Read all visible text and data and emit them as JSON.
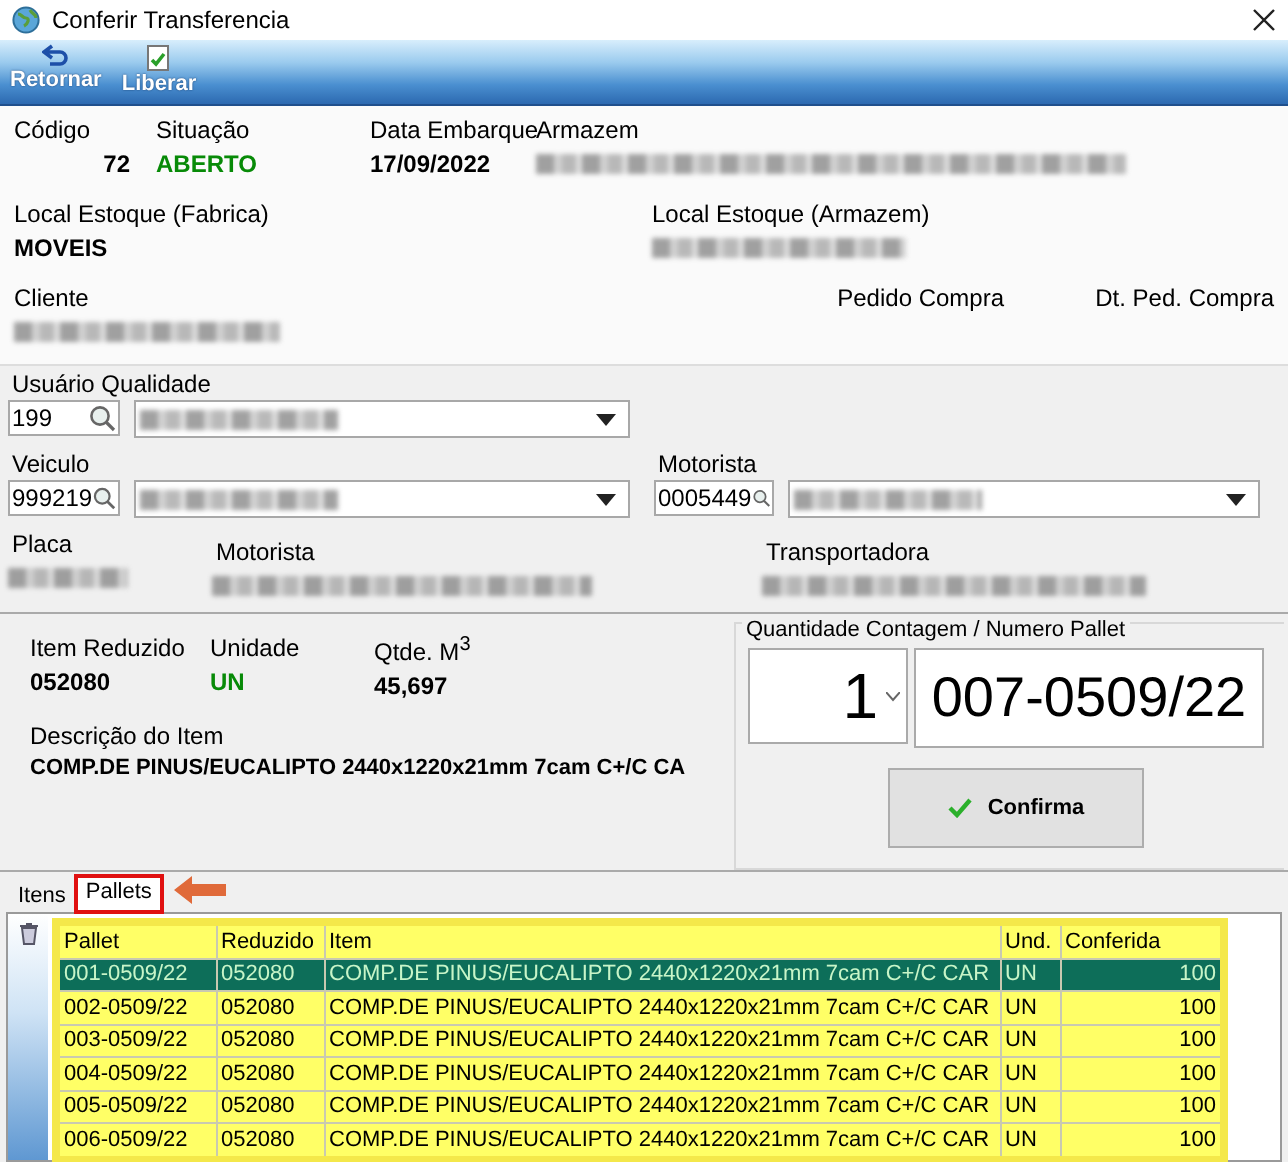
{
  "window": {
    "title": "Conferir Transferencia"
  },
  "toolbar": [
    {
      "label": "Retornar",
      "kind": "return"
    },
    {
      "label": "Liberar",
      "kind": "release"
    }
  ],
  "header": {
    "codigo": {
      "label": "Código",
      "value": "72"
    },
    "situacao": {
      "label": "Situação",
      "value": "ABERTO"
    },
    "data_embarque": {
      "label": "Data Embarque",
      "value": "17/09/2022"
    },
    "armazem": {
      "label": "Armazem",
      "redacted": true
    },
    "local_fabrica": {
      "label": "Local Estoque (Fabrica)",
      "value": "MOVEIS"
    },
    "local_armazem": {
      "label": "Local Estoque (Armazem)",
      "redacted": true
    },
    "cliente": {
      "label": "Cliente",
      "redacted": true
    },
    "pedido_compra": {
      "label": "Pedido Compra"
    },
    "dt_ped_compra": {
      "label": "Dt. Ped. Compra"
    }
  },
  "form": {
    "usuario_qualidade": {
      "label": "Usuário Qualidade",
      "code": "199",
      "redacted": true
    },
    "veiculo": {
      "label": "Veiculo",
      "code": "999219",
      "redacted": true
    },
    "motorista": {
      "label": "Motorista",
      "code": "0005449",
      "redacted": true
    },
    "placa": {
      "label": "Placa",
      "redacted": true
    },
    "motorista_nome": {
      "label": "Motorista",
      "redacted": true
    },
    "transportadora": {
      "label": "Transportadora",
      "redacted": true
    }
  },
  "item": {
    "item_reduzido": {
      "label": "Item Reduzido",
      "value": "052080"
    },
    "unidade": {
      "label": "Unidade",
      "value": "UN"
    },
    "qtde": {
      "label": "Qtde. M$^{3}$",
      "value": "45,697"
    },
    "descricao": {
      "label": "Descrição do Item",
      "value": "COMP.DE PINUS/EUCALIPTO 2440x1220x21mm 7cam  C+/C CA"
    }
  },
  "counter": {
    "title": "Quantidade Contagem / Numero Pallet",
    "quantity": "1",
    "pallet": "007-0509/22",
    "button": "Confirma"
  },
  "tabs": [
    {
      "label": "Itens",
      "selected": false,
      "highlighted": false
    },
    {
      "label": "Pallets",
      "selected": true,
      "highlighted": true
    }
  ],
  "table": {
    "columns": [
      "Pallet",
      "Reduzido",
      "Item",
      "Und.",
      "Conferida"
    ],
    "rows": [
      {
        "cells": [
          "001-0509/22",
          "052080",
          "COMP.DE PINUS/EUCALIPTO 2440x1220x21mm 7cam  C+/C CAR",
          "UN",
          "100"
        ],
        "selected": true
      },
      {
        "cells": [
          "002-0509/22",
          "052080",
          "COMP.DE PINUS/EUCALIPTO 2440x1220x21mm 7cam  C+/C CAR",
          "UN",
          "100"
        ],
        "selected": false
      },
      {
        "cells": [
          "003-0509/22",
          "052080",
          "COMP.DE PINUS/EUCALIPTO 2440x1220x21mm 7cam  C+/C CAR",
          "UN",
          "100"
        ],
        "selected": false
      },
      {
        "cells": [
          "004-0509/22",
          "052080",
          "COMP.DE PINUS/EUCALIPTO 2440x1220x21mm 7cam  C+/C CAR",
          "UN",
          "100"
        ],
        "selected": false
      },
      {
        "cells": [
          "005-0509/22",
          "052080",
          "COMP.DE PINUS/EUCALIPTO 2440x1220x21mm 7cam  C+/C CAR",
          "UN",
          "100"
        ],
        "selected": false
      },
      {
        "cells": [
          "006-0509/22",
          "052080",
          "COMP.DE PINUS/EUCALIPTO 2440x1220x21mm 7cam  C+/C CAR",
          "UN",
          "100"
        ],
        "selected": false
      }
    ]
  }
}
